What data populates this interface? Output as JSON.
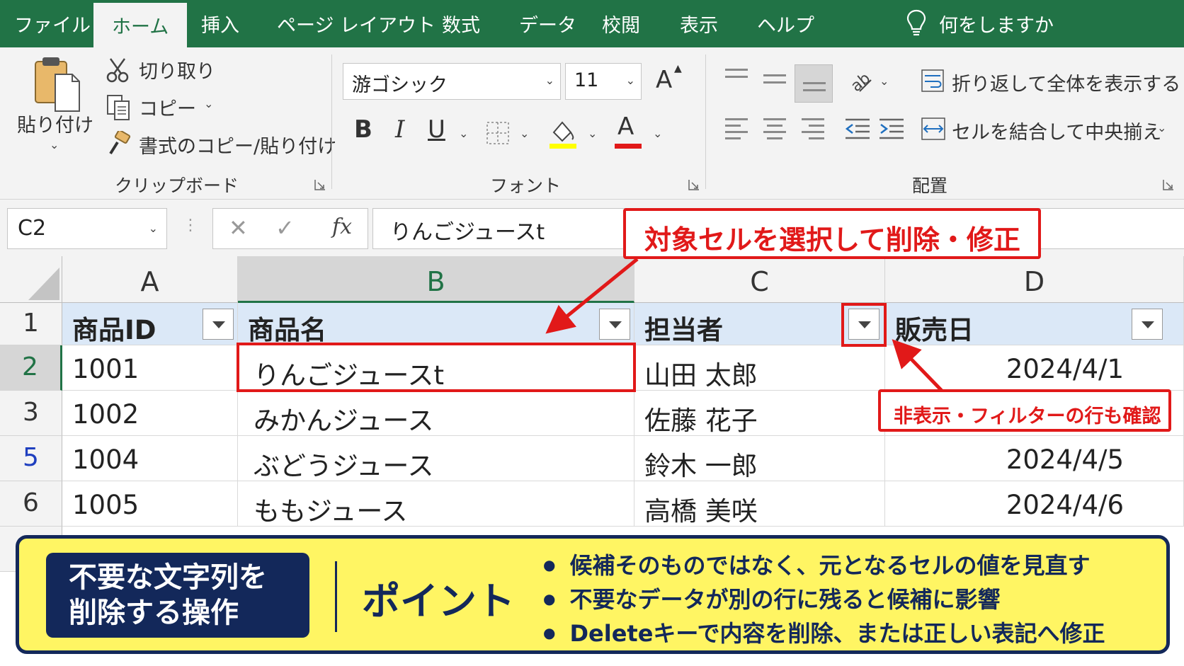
{
  "tabs": [
    "ファイル",
    "ホーム",
    "挿入",
    "ページ レイアウト",
    "数式",
    "データ",
    "校閲",
    "表示",
    "ヘルプ"
  ],
  "tell_me": "何をしますか",
  "clipboard": {
    "paste": "貼り付け",
    "cut": "切り取り",
    "copy": "コピー",
    "format_painter": "書式のコピー/貼り付け",
    "group_label": "クリップボード"
  },
  "font": {
    "name": "游ゴシック",
    "size": "11",
    "grow": "A",
    "bold": "B",
    "italic": "I",
    "underline": "U",
    "font_color": "A",
    "group_label": "フォント"
  },
  "alignment": {
    "wrap_text": "折り返して全体を表示する",
    "merge_center": "セルを結合して中央揃え",
    "group_label": "配置"
  },
  "formula_bar": {
    "name_box": "C2",
    "fx": "fx",
    "content": "りんごジュースt"
  },
  "columns": [
    "A",
    "B",
    "C",
    "D"
  ],
  "rows": [
    {
      "num": "1",
      "cells": [
        "商品ID",
        "商品名",
        "担当者",
        "販売日"
      ]
    },
    {
      "num": "2",
      "cells": [
        "1001",
        "りんごジュースt",
        "山田 太郎",
        "2024/4/1"
      ]
    },
    {
      "num": "3",
      "cells": [
        "1002",
        "みかんジュース",
        "佐藤 花子",
        ""
      ]
    },
    {
      "num": "5",
      "cells": [
        "1004",
        "ぶどうジュース",
        "鈴木 一郎",
        "2024/4/5"
      ]
    },
    {
      "num": "6",
      "cells": [
        "1005",
        "ももジュース",
        "高橋 美咲",
        "2024/4/6"
      ]
    }
  ],
  "callouts": {
    "select_cell": "対象セルを選択して削除・修正",
    "check_hidden": "非表示・フィルターの行も確認"
  },
  "panel": {
    "title_line1": "不要な文字列を",
    "title_line2": "削除する操作",
    "point": "ポイント",
    "bullets": [
      "候補そのものではなく、元となるセルの値を見直す",
      "不要なデータが別の行に残ると候補に影響",
      "Deleteキーで内容を削除、または正しい表記へ修正"
    ]
  },
  "colors": {
    "excel_green": "#217346",
    "header_fill": "#dbe8f7",
    "callout_red": "#e11919",
    "panel_yellow": "#fff563",
    "panel_navy": "#13285a"
  }
}
